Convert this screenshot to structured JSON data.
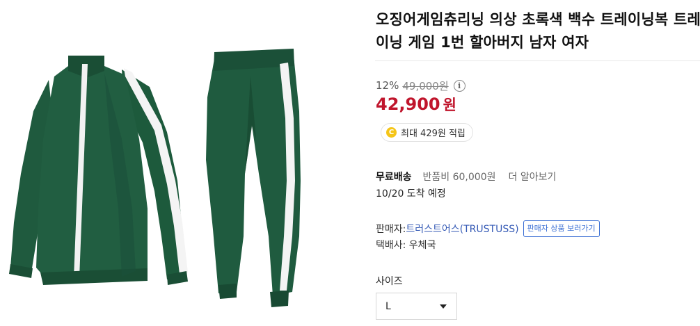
{
  "product": {
    "title": "오징어게임츄리닝 의상 초록색 백수 트레이닝복 트레이닝 게임 1번 할아버지 남자 여자",
    "image_alt": "green tracksuit jacket and pants with white stripes"
  },
  "price": {
    "discount_rate": "12%",
    "original_price": "49,000원",
    "sale_price": "42,900",
    "sale_currency": "원",
    "info_icon": "info-icon",
    "sale_color": "#c0152c"
  },
  "points": {
    "coin_symbol": "C",
    "text": "최대 429원 적립",
    "coin_color": "#f5c518"
  },
  "shipping": {
    "free_label": "무료배송",
    "return_fee": "반품비 60,000원",
    "more_link": "더 알아보기",
    "arrival": "10/20 도착 예정"
  },
  "seller": {
    "label": "판매자: ",
    "name": "트러스트어스(TRUSTUSS)",
    "view_products_button": "판매자 상품 보러가기",
    "courier": "택배사: 우체국",
    "link_color": "#3459b5"
  },
  "options": {
    "size_label": "사이즈",
    "size_selected": "L"
  }
}
